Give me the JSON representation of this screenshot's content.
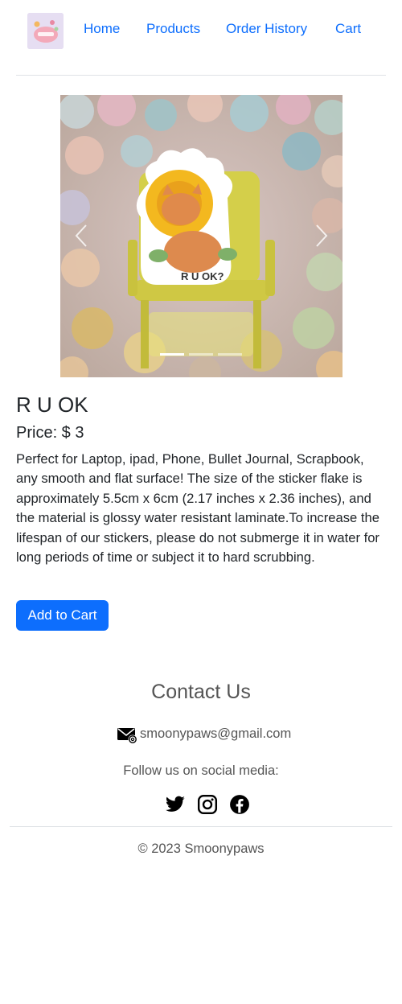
{
  "nav": {
    "logo": "smoonypaws-logo",
    "items": [
      {
        "label": "Home"
      },
      {
        "label": "Products"
      },
      {
        "label": "Order History"
      },
      {
        "label": "Cart"
      }
    ]
  },
  "carousel": {
    "slide_count": 3,
    "active_index": 0,
    "sticker_text": "R U OK?",
    "prev_icon": "chevron-left-icon",
    "next_icon": "chevron-right-icon"
  },
  "product": {
    "title": "R U OK",
    "price_label": "Price: $ 3",
    "description": "Perfect for Laptop, ipad, Phone, Bullet Journal, Scrapbook, any smooth and flat surface! The size of the sticker flake is approximately 5.5cm x 6cm (2.17 inches x 2.36 inches), and the material is glossy water resistant laminate.To increase the lifespan of our stickers, please do not submerge it in water for long periods of time or subject it to hard scrubbing.",
    "add_to_cart": "Add to Cart"
  },
  "footer": {
    "contact_title": "Contact Us",
    "email_icon": "envelope-at-icon",
    "email": "smoonypaws@gmail.com",
    "follow": "Follow us on social media:",
    "social_icons": [
      "twitter-icon",
      "instagram-icon",
      "facebook-icon"
    ],
    "copyright": "© 2023 Smoonypaws"
  },
  "colors": {
    "primary": "#0d6efd",
    "text": "#212529",
    "muted": "#555555",
    "divider": "#dee2e6"
  }
}
